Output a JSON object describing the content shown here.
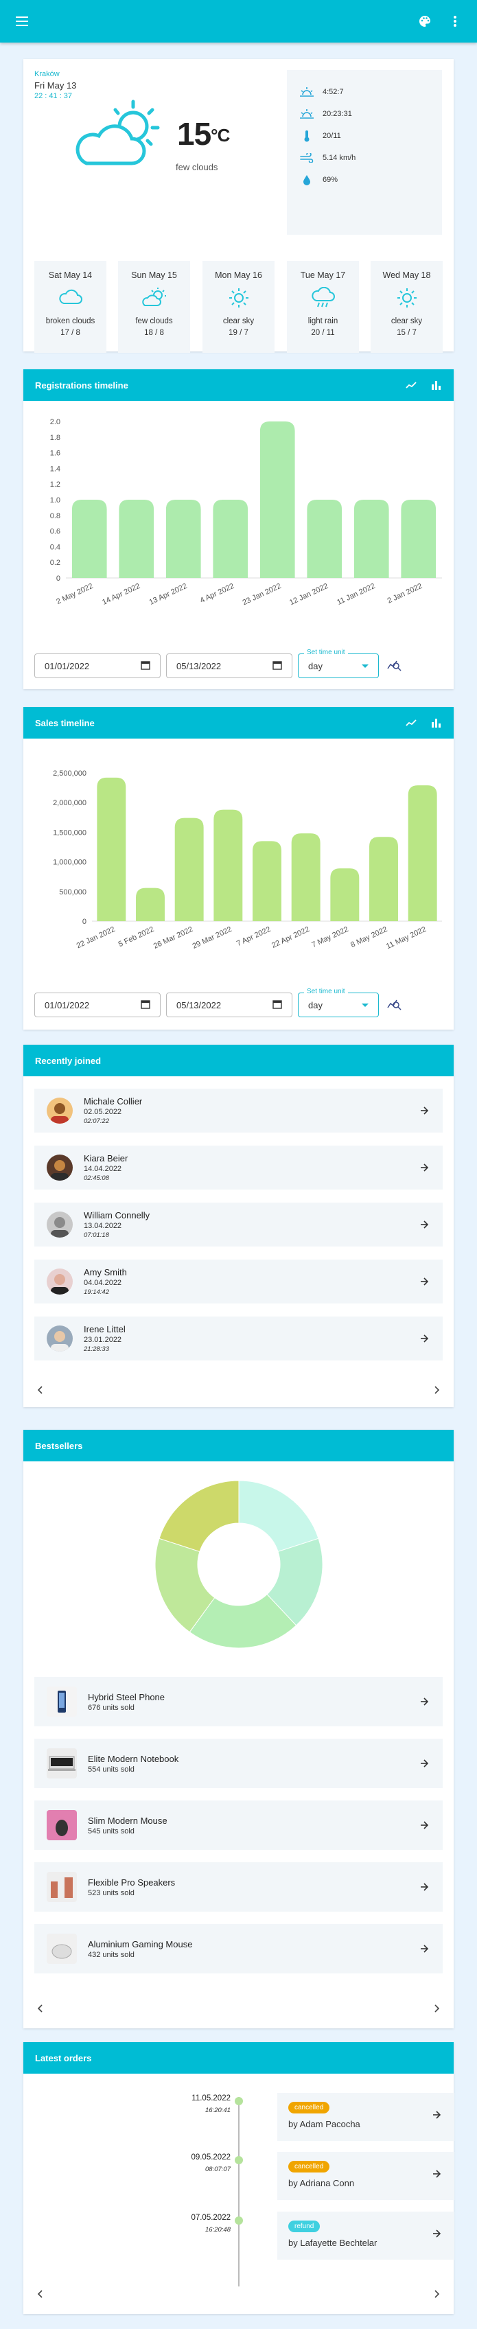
{
  "appbar": {
    "menu_icon": "menu-icon",
    "palette_icon": "palette-icon",
    "more_icon": "more-vert-icon"
  },
  "weather": {
    "city": "Kraków",
    "date": "Fri May 13",
    "time": "22 : 41 : 37",
    "temp": "15",
    "unit": "°C",
    "description": "few clouds",
    "stats": [
      {
        "icon": "sunrise-icon",
        "value": "4:52:7"
      },
      {
        "icon": "sunset-icon",
        "value": "20:23:31"
      },
      {
        "icon": "thermometer-icon",
        "value": "20/11"
      },
      {
        "icon": "wind-icon",
        "value": "5.14 km/h"
      },
      {
        "icon": "humidity-icon",
        "value": "69%"
      }
    ],
    "forecast": [
      {
        "day": "Sat May 14",
        "icon": "cloud-icon",
        "desc": "broken clouds",
        "temp": "17 / 8"
      },
      {
        "day": "Sun May 15",
        "icon": "partly-cloudy-icon",
        "desc": "few clouds",
        "temp": "18 / 8"
      },
      {
        "day": "Mon May 16",
        "icon": "sun-icon",
        "desc": "clear sky",
        "temp": "19 / 7"
      },
      {
        "day": "Tue May 17",
        "icon": "rain-icon",
        "desc": "light rain",
        "temp": "20 / 11"
      },
      {
        "day": "Wed May 18",
        "icon": "sun-icon",
        "desc": "clear sky",
        "temp": "15 / 7"
      }
    ]
  },
  "registrations": {
    "title": "Registrations timeline",
    "date_from": "01/01/2022",
    "date_to": "05/13/2022",
    "unit_label": "Set time unit",
    "unit_value": "day"
  },
  "sales": {
    "title": "Sales timeline",
    "date_from": "01/01/2022",
    "date_to": "05/13/2022",
    "unit_label": "Set time unit",
    "unit_value": "day"
  },
  "chart_data": [
    {
      "type": "bar",
      "categories": [
        "2 May 2022",
        "14 Apr 2022",
        "13 Apr 2022",
        "4 Apr 2022",
        "23 Jan 2022",
        "12 Jan 2022",
        "11 Jan 2022",
        "2 Jan 2022"
      ],
      "values": [
        1,
        1,
        1,
        1,
        2,
        1,
        1,
        1
      ],
      "ylim": [
        0,
        2
      ],
      "yticks": [
        "0",
        "0.2",
        "0.4",
        "0.6",
        "0.8",
        "1.0",
        "1.2",
        "1.4",
        "1.6",
        "1.8",
        "2.0"
      ],
      "color": "#adebad"
    },
    {
      "type": "bar",
      "categories": [
        "22 Jan 2022",
        "5 Feb 2022",
        "26 Mar 2022",
        "29 Mar 2022",
        "7 Apr 2022",
        "22 Apr 2022",
        "7 May 2022",
        "8 May 2022",
        "11 May 2022"
      ],
      "values": [
        2420000,
        560000,
        1740000,
        1880000,
        1350000,
        1480000,
        890000,
        1420000,
        2290000
      ],
      "ylim": [
        0,
        2500000
      ],
      "yticks": [
        "0",
        "500,000",
        "1,000,000",
        "1,500,000",
        "2,000,000",
        "2,500,000"
      ],
      "color": "#b9e685"
    },
    {
      "type": "pie",
      "values": [
        20,
        18,
        22,
        20,
        20
      ],
      "colors": [
        "#c8f7ea",
        "#b8f0d2",
        "#b4eeb4",
        "#bfe89a",
        "#cdd96a"
      ]
    }
  ],
  "recent": {
    "title": "Recently joined",
    "items": [
      {
        "name": "Michale Collier",
        "date": "02.05.2022",
        "time": "02:07:22"
      },
      {
        "name": "Kiara Beier",
        "date": "14.04.2022",
        "time": "02:45:08"
      },
      {
        "name": "William Connelly",
        "date": "13.04.2022",
        "time": "07:01:18"
      },
      {
        "name": "Amy Smith",
        "date": "04.04.2022",
        "time": "19:14:42"
      },
      {
        "name": "Irene Littel",
        "date": "23.01.2022",
        "time": "21:28:33"
      }
    ]
  },
  "bestsellers": {
    "title": "Bestsellers",
    "items": [
      {
        "name": "Hybrid Steel Phone",
        "sold": "676 units sold"
      },
      {
        "name": "Elite Modern Notebook",
        "sold": "554 units sold"
      },
      {
        "name": "Slim Modern Mouse",
        "sold": "545 units sold"
      },
      {
        "name": "Flexible Pro Speakers",
        "sold": "523 units sold"
      },
      {
        "name": "Aluminium Gaming Mouse",
        "sold": "432 units sold"
      }
    ]
  },
  "orders": {
    "title": "Latest orders",
    "items": [
      {
        "date": "11.05.2022",
        "time": "16:20:41",
        "status": "cancelled",
        "status_color": "#f0a500",
        "by": "by Adam Pacocha"
      },
      {
        "date": "09.05.2022",
        "time": "08:07:07",
        "status": "cancelled",
        "status_color": "#f0a500",
        "by": "by Adriana Conn"
      },
      {
        "date": "07.05.2022",
        "time": "16:20:48",
        "status": "refund",
        "status_color": "#3fd0e0",
        "by": "by Lafayette Bechtelar"
      }
    ]
  }
}
